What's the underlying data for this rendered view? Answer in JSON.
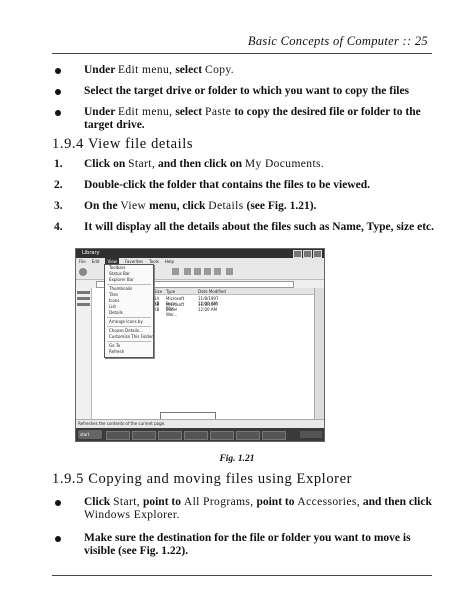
{
  "header": {
    "title": "Basic Concepts of Computer :: 25"
  },
  "top_bullets": [
    {
      "bold": "Under",
      "regular": "Edit menu,",
      "bold2": "select",
      "regular2": "Copy.",
      "rest": ""
    },
    {
      "text": "Select the target drive or folder to which you want to copy the files"
    },
    {
      "bold": "Under",
      "regular": "Edit menu,",
      "bold2": "select",
      "regular2": "Paste",
      "rest": "to copy the desired file or folder to the target drive."
    }
  ],
  "section_194": {
    "title": "1.9.4 View file details"
  },
  "steps": [
    {
      "num": "1.",
      "a": "Click on",
      "b": "Start,",
      "c": "and then click on",
      "d": "My Documents.",
      "e": ""
    },
    {
      "num": "2.",
      "a": "Double-click the folder that contains the files to be viewed.",
      "b": "",
      "c": "",
      "d": "",
      "e": ""
    },
    {
      "num": "3.",
      "a": "On the",
      "b": "View",
      "c": "menu, click",
      "d": "Details",
      "e": "(see Fig. 1.21)."
    },
    {
      "num": "4.",
      "a": "It will display all the details about the files such as Name, Type, size etc.",
      "b": "",
      "c": "",
      "d": "",
      "e": ""
    }
  ],
  "figure": {
    "caption": "Fig. 1.21",
    "window_title": "Library",
    "menubar": [
      "File",
      "Edit",
      "View",
      "Favorites",
      "Tools",
      "Help"
    ],
    "active_menu": "View",
    "view_menu_items": [
      "Toolbars",
      "Status Bar",
      "Explorer Bar",
      "Thumbnails",
      "Tiles",
      "Icons",
      "List",
      "Details",
      "Arrange Icons by",
      "Choose Details...",
      "Customize This Folder...",
      "Go To",
      "Refresh"
    ],
    "columns": [
      "Size",
      "Type",
      "Date Modified"
    ],
    "rows": [
      {
        "size": "14 KB",
        "type": "Microsoft Excel Wor...",
        "date": "11/8/1997 12:00 AM"
      },
      {
        "size": "28 KB",
        "type": "Microsoft Excel Wor...",
        "date": "11/8/1997 12:00 AM"
      }
    ],
    "status_text": "Refreshes the contents of the current page.",
    "start_label": "start"
  },
  "section_195": {
    "title": "1.9.5 Copying and moving files using Explorer"
  },
  "bottom_bullets": [
    {
      "b1": "Click",
      "r1": "Start,",
      "b2": "point to",
      "r2": "All Programs,",
      "b3": "point to",
      "r3": "Accessories,",
      "b4": "and then click",
      "r4": "Windows Explorer."
    },
    {
      "text": "Make sure the destination for the file or folder you want to move is visible (see Fig. 1.22)."
    }
  ]
}
